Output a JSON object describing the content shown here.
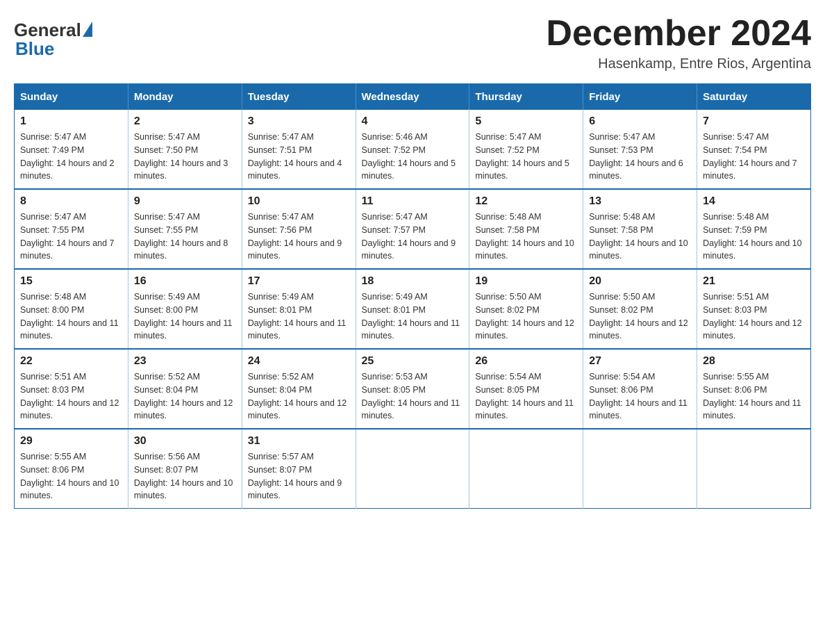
{
  "logo": {
    "general": "General",
    "blue": "Blue"
  },
  "title": "December 2024",
  "subtitle": "Hasenkamp, Entre Rios, Argentina",
  "days_header": [
    "Sunday",
    "Monday",
    "Tuesday",
    "Wednesday",
    "Thursday",
    "Friday",
    "Saturday"
  ],
  "weeks": [
    [
      {
        "day": "1",
        "sunrise": "5:47 AM",
        "sunset": "7:49 PM",
        "daylight": "14 hours and 2 minutes."
      },
      {
        "day": "2",
        "sunrise": "5:47 AM",
        "sunset": "7:50 PM",
        "daylight": "14 hours and 3 minutes."
      },
      {
        "day": "3",
        "sunrise": "5:47 AM",
        "sunset": "7:51 PM",
        "daylight": "14 hours and 4 minutes."
      },
      {
        "day": "4",
        "sunrise": "5:46 AM",
        "sunset": "7:52 PM",
        "daylight": "14 hours and 5 minutes."
      },
      {
        "day": "5",
        "sunrise": "5:47 AM",
        "sunset": "7:52 PM",
        "daylight": "14 hours and 5 minutes."
      },
      {
        "day": "6",
        "sunrise": "5:47 AM",
        "sunset": "7:53 PM",
        "daylight": "14 hours and 6 minutes."
      },
      {
        "day": "7",
        "sunrise": "5:47 AM",
        "sunset": "7:54 PM",
        "daylight": "14 hours and 7 minutes."
      }
    ],
    [
      {
        "day": "8",
        "sunrise": "5:47 AM",
        "sunset": "7:55 PM",
        "daylight": "14 hours and 7 minutes."
      },
      {
        "day": "9",
        "sunrise": "5:47 AM",
        "sunset": "7:55 PM",
        "daylight": "14 hours and 8 minutes."
      },
      {
        "day": "10",
        "sunrise": "5:47 AM",
        "sunset": "7:56 PM",
        "daylight": "14 hours and 9 minutes."
      },
      {
        "day": "11",
        "sunrise": "5:47 AM",
        "sunset": "7:57 PM",
        "daylight": "14 hours and 9 minutes."
      },
      {
        "day": "12",
        "sunrise": "5:48 AM",
        "sunset": "7:58 PM",
        "daylight": "14 hours and 10 minutes."
      },
      {
        "day": "13",
        "sunrise": "5:48 AM",
        "sunset": "7:58 PM",
        "daylight": "14 hours and 10 minutes."
      },
      {
        "day": "14",
        "sunrise": "5:48 AM",
        "sunset": "7:59 PM",
        "daylight": "14 hours and 10 minutes."
      }
    ],
    [
      {
        "day": "15",
        "sunrise": "5:48 AM",
        "sunset": "8:00 PM",
        "daylight": "14 hours and 11 minutes."
      },
      {
        "day": "16",
        "sunrise": "5:49 AM",
        "sunset": "8:00 PM",
        "daylight": "14 hours and 11 minutes."
      },
      {
        "day": "17",
        "sunrise": "5:49 AM",
        "sunset": "8:01 PM",
        "daylight": "14 hours and 11 minutes."
      },
      {
        "day": "18",
        "sunrise": "5:49 AM",
        "sunset": "8:01 PM",
        "daylight": "14 hours and 11 minutes."
      },
      {
        "day": "19",
        "sunrise": "5:50 AM",
        "sunset": "8:02 PM",
        "daylight": "14 hours and 12 minutes."
      },
      {
        "day": "20",
        "sunrise": "5:50 AM",
        "sunset": "8:02 PM",
        "daylight": "14 hours and 12 minutes."
      },
      {
        "day": "21",
        "sunrise": "5:51 AM",
        "sunset": "8:03 PM",
        "daylight": "14 hours and 12 minutes."
      }
    ],
    [
      {
        "day": "22",
        "sunrise": "5:51 AM",
        "sunset": "8:03 PM",
        "daylight": "14 hours and 12 minutes."
      },
      {
        "day": "23",
        "sunrise": "5:52 AM",
        "sunset": "8:04 PM",
        "daylight": "14 hours and 12 minutes."
      },
      {
        "day": "24",
        "sunrise": "5:52 AM",
        "sunset": "8:04 PM",
        "daylight": "14 hours and 12 minutes."
      },
      {
        "day": "25",
        "sunrise": "5:53 AM",
        "sunset": "8:05 PM",
        "daylight": "14 hours and 11 minutes."
      },
      {
        "day": "26",
        "sunrise": "5:54 AM",
        "sunset": "8:05 PM",
        "daylight": "14 hours and 11 minutes."
      },
      {
        "day": "27",
        "sunrise": "5:54 AM",
        "sunset": "8:06 PM",
        "daylight": "14 hours and 11 minutes."
      },
      {
        "day": "28",
        "sunrise": "5:55 AM",
        "sunset": "8:06 PM",
        "daylight": "14 hours and 11 minutes."
      }
    ],
    [
      {
        "day": "29",
        "sunrise": "5:55 AM",
        "sunset": "8:06 PM",
        "daylight": "14 hours and 10 minutes."
      },
      {
        "day": "30",
        "sunrise": "5:56 AM",
        "sunset": "8:07 PM",
        "daylight": "14 hours and 10 minutes."
      },
      {
        "day": "31",
        "sunrise": "5:57 AM",
        "sunset": "8:07 PM",
        "daylight": "14 hours and 9 minutes."
      },
      null,
      null,
      null,
      null
    ]
  ]
}
